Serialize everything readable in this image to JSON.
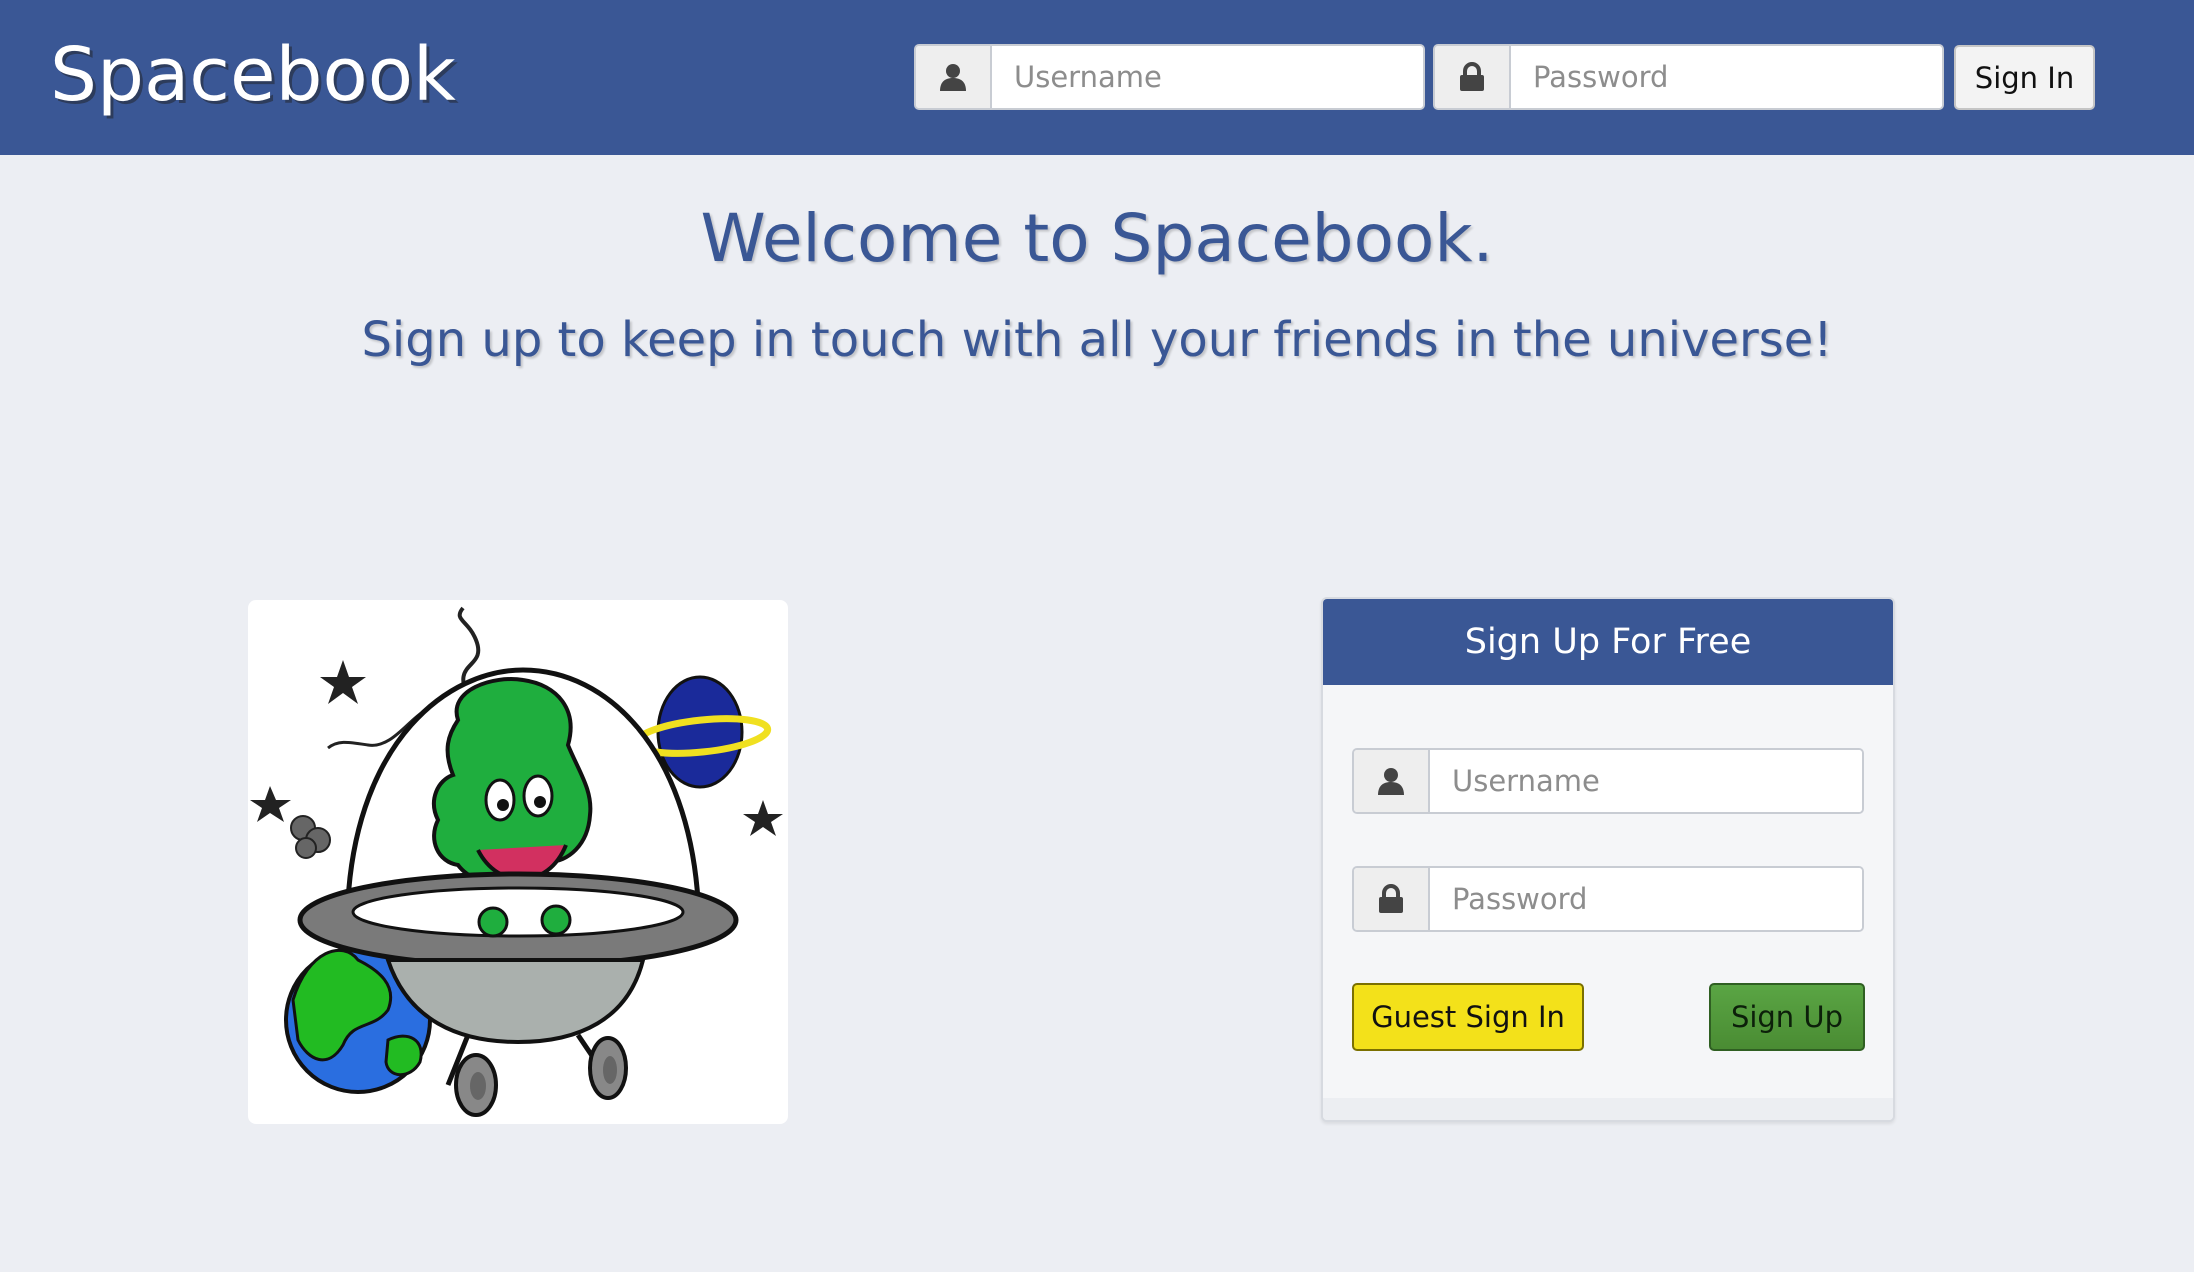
{
  "navbar": {
    "brand": "Spacebook",
    "username_placeholder": "Username",
    "password_placeholder": "Password",
    "signin_label": "Sign In"
  },
  "hero": {
    "title": "Welcome to Spacebook.",
    "subtitle": "Sign up to keep in touch with all your friends in the universe!"
  },
  "illustration": {
    "icon": "alien-spaceship-illustration"
  },
  "signup": {
    "heading": "Sign Up For Free",
    "username_placeholder": "Username",
    "password_placeholder": "Password",
    "guest_label": "Guest Sign In",
    "signup_label": "Sign Up"
  },
  "colors": {
    "brand_blue": "#3a5795",
    "background": "#eceef3",
    "guest_yellow": "#f3e11a",
    "signup_green": "#539b3a"
  }
}
